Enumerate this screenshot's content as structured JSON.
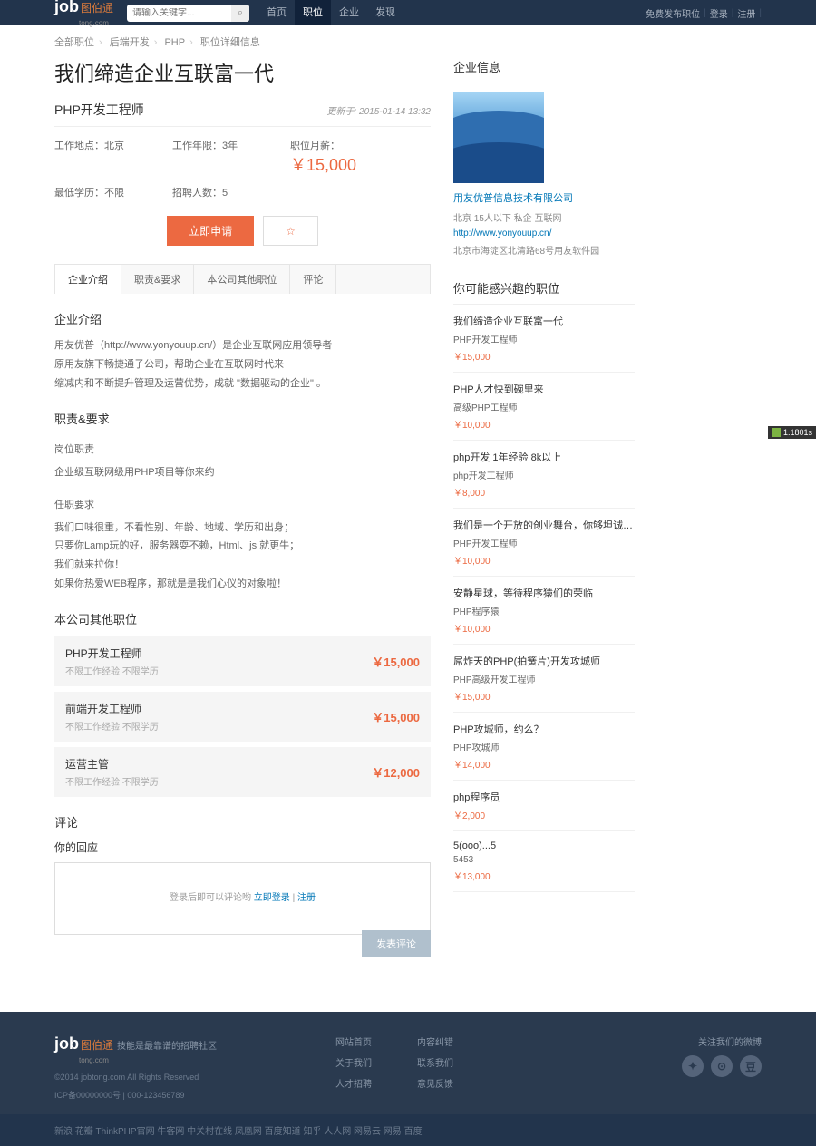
{
  "header": {
    "logo_main": "job",
    "logo_cn": "图伯通",
    "logo_sub": "tong.com",
    "search_placeholder": "请输入关键字...",
    "nav": [
      "首页",
      "职位",
      "企业",
      "发现"
    ],
    "nav_active": 1,
    "right": {
      "post": "免费发布职位",
      "login": "登录",
      "register": "注册"
    }
  },
  "breadcrumb": [
    "全部职位",
    "后端开发",
    "PHP",
    "职位详细信息"
  ],
  "title": "我们缔造企业互联富一代",
  "subtitle": "PHP开发工程师",
  "update": "更新于: 2015-01-14 13:32",
  "info": {
    "loc_label": "工作地点：",
    "loc": "北京",
    "exp_label": "工作年限：",
    "exp": "3年",
    "sal_label": "职位月薪：",
    "sal": "￥15,000",
    "edu_label": "最低学历：",
    "edu": "不限",
    "num_label": "招聘人数：",
    "num": "5"
  },
  "actions": {
    "apply": "立即申请",
    "fav": "☆"
  },
  "tabs": [
    "企业介绍",
    "职责&要求",
    "本公司其他职位",
    "评论"
  ],
  "intro": {
    "h": "企业介绍",
    "p1": "用友优普（http://www.yonyouup.cn/）是企业互联网应用领导者",
    "p2": "原用友旗下畅捷通子公司，帮助企业在互联网时代来",
    "p3": "缩减内和不断提升管理及运营优势，成就 \"数据驱动的企业\" 。"
  },
  "duty": {
    "h": "职责&要求",
    "sh1": "岗位职责",
    "p1": "企业级互联网级用PHP项目等你来约",
    "sh2": "任职要求",
    "p2": "我们口味很重，不看性别、年龄、地域、学历和出身；",
    "p3": "只要你Lamp玩的好，服务器耍不赖，Html、js 就更牛；",
    "p4": "我们就来拉你！",
    "p5": "如果你热爱WEB程序，那就是是我们心仪的对象啦！"
  },
  "otherjobs": {
    "h": "本公司其他职位",
    "items": [
      {
        "t": "PHP开发工程师",
        "m": "不限工作经验  不限学历",
        "p": "￥15,000"
      },
      {
        "t": "前端开发工程师",
        "m": "不限工作经验  不限学历",
        "p": "￥15,000"
      },
      {
        "t": "运营主管",
        "m": "不限工作经验  不限学历",
        "p": "￥12,000"
      }
    ]
  },
  "comment": {
    "h": "评论",
    "ch": "你的回应",
    "hint1": "登录后即可以评论哟  ",
    "login": "立即登录",
    "sep": " | ",
    "reg": "注册",
    "submit": "发表评论"
  },
  "company": {
    "h": "企业信息",
    "name": "用友优普信息技术有限公司",
    "meta": "北京   15人以下   私企   互联网",
    "link": "http://www.yonyouup.cn/",
    "addr": "北京市海淀区北清路68号用友软件园"
  },
  "interest": {
    "h": "你可能感兴趣的职位",
    "items": [
      {
        "t": "我们缔造企业互联富一代",
        "j": "PHP开发工程师",
        "p": "￥15,000"
      },
      {
        "t": "PHP人才快到碗里来",
        "j": "高级PHP工程师",
        "p": "￥10,000"
      },
      {
        "t": "php开发 1年经验 8k以上",
        "j": "php开发工程师",
        "p": "￥8,000"
      },
      {
        "t": "我们是一个开放的创业舞台，你够坦诚、够任性，...",
        "j": "PHP开发工程师",
        "p": "￥10,000"
      },
      {
        "t": "安静星球，等待程序猿们的荣临",
        "j": "PHP程序猿",
        "p": "￥10,000"
      },
      {
        "t": "屌炸天的PHP(拍簧片)开发攻城师",
        "j": "PHP高级开发工程师",
        "p": "￥15,000"
      },
      {
        "t": "PHP攻城师，约么？",
        "j": "PHP攻城师",
        "p": "￥14,000"
      },
      {
        "t": "php程序员",
        "j": "",
        "p": "￥2,000"
      },
      {
        "t": "5(ooo)...5",
        "j": "5453",
        "p": "￥13,000"
      }
    ]
  },
  "footer": {
    "tag": "技能是最靠谱的招聘社区",
    "copy1": "©2014 jobtong.com All Rights Reserved",
    "copy2": "ICP备00000000号 | 000-123456789",
    "col1": [
      "网站首页",
      "关于我们",
      "人才招聘"
    ],
    "col2": [
      "内容纠错",
      "联系我们",
      "意见反馈"
    ],
    "social_h": "关注我们的微博",
    "friends_label": "新浪  花瓣  ThinkPHP官网  牛客网  中关村在线  凤凰网  百度知道  知乎  人人网  网易云  网易  百度"
  },
  "badge": "1.1801s"
}
